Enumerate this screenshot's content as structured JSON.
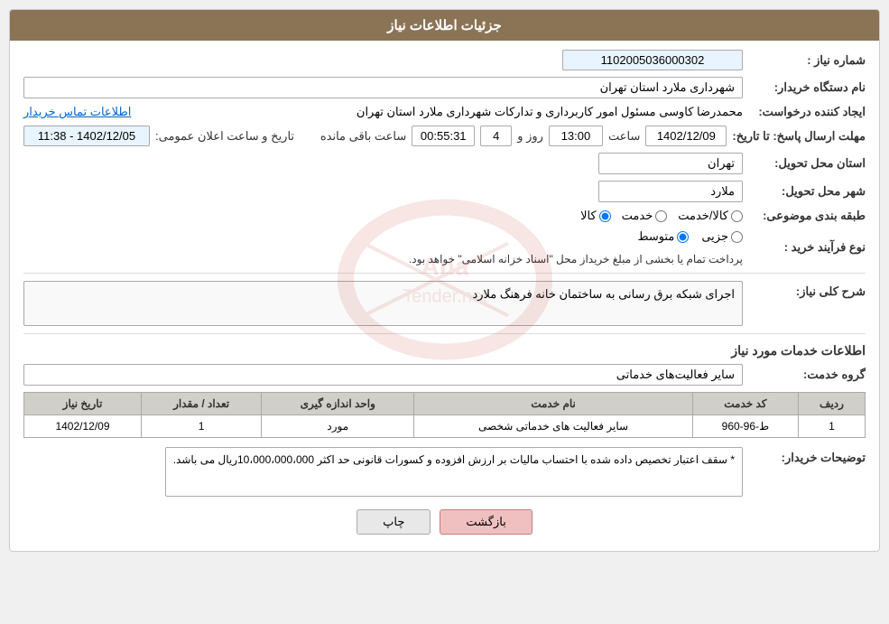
{
  "header": {
    "title": "جزئیات اطلاعات نیاز"
  },
  "fields": {
    "need_number_label": "شماره نیاز :",
    "need_number_value": "1102005036000302",
    "buyer_org_label": "نام دستگاه خریدار:",
    "buyer_org_value": "شهرداری ملارد استان تهران",
    "creator_label": "ایجاد کننده درخواست:",
    "creator_value": "محمدرضا کاوسی مسئول امور کاربرداری و تدارکات  شهرداری ملارد استان تهران",
    "contact_link": "اطلاعات تماس خریدار",
    "deadline_label": "مهلت ارسال پاسخ: تا تاریخ:",
    "announce_label": "تاریخ و ساعت اعلان عمومی:",
    "announce_date": "1402/12/05 - 11:38",
    "deadline_date": "1402/12/09",
    "deadline_time_label": "ساعت",
    "deadline_time": "13:00",
    "days_label": "روز و",
    "days_value": "4",
    "remaining_label": "ساعت باقی مانده",
    "remaining_time": "00:55:31",
    "province_label": "استان محل تحویل:",
    "province_value": "تهران",
    "city_label": "شهر محل تحویل:",
    "city_value": "ملارد",
    "category_label": "طبقه بندی موضوعی:",
    "category_options": [
      "کالا",
      "خدمت",
      "کالا/خدمت"
    ],
    "category_selected": "کالا",
    "procurement_label": "نوع فرآیند خرید :",
    "procurement_options": [
      "جزیی",
      "متوسط"
    ],
    "procurement_note": "پرداخت تمام یا بخشی از مبلغ خریداز محل \"اسناد خزانه اسلامی\" خواهد بود.",
    "description_label": "شرح کلی نیاز:",
    "description_value": "اجرای شبکه برق رسانی به ساختمان خانه فرهنگ ملارد",
    "services_section_label": "اطلاعات خدمات مورد نیاز",
    "service_group_label": "گروه خدمت:",
    "service_group_value": "سایر فعالیت‌های خدماتی",
    "table_headers": [
      "ردیف",
      "کد خدمت",
      "نام خدمت",
      "واحد اندازه گیری",
      "تعداد / مقدار",
      "تاریخ نیاز"
    ],
    "table_rows": [
      {
        "row": "1",
        "service_code": "ط-96-960",
        "service_name": "سایر فعالیت های خدماتی شخصی",
        "unit": "مورد",
        "quantity": "1",
        "date": "1402/12/09"
      }
    ],
    "buyer_notes_label": "توضیحات خریدار:",
    "buyer_notes_value": "* سقف اعتبار تخصیص داده شده با احتساب مالیات بر ارزش افزوده و کسورات قانونی حد اکثر 10،000،000،000ریال می باشد."
  },
  "buttons": {
    "print_label": "چاپ",
    "back_label": "بازگشت"
  }
}
